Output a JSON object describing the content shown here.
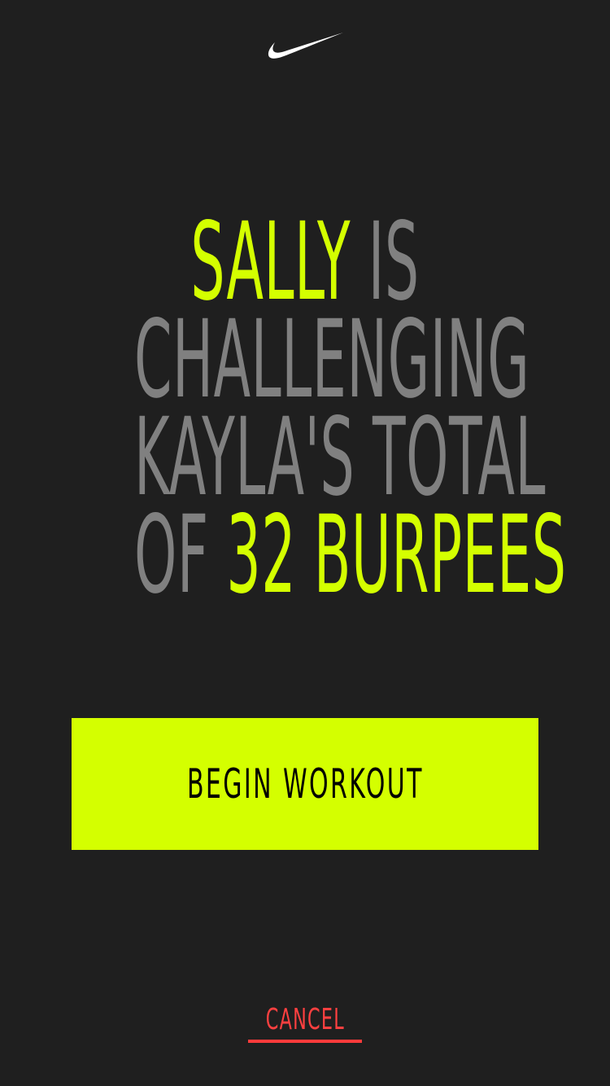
{
  "app": {
    "logo_icon": "nike-swoosh-icon"
  },
  "challenge": {
    "challenger": "SALLY",
    "line1_rest": " IS",
    "line2": "CHALLENGING",
    "line3": "KAYLA'S TOTAL",
    "line4_prefix": "OF ",
    "total_text": "32 BURPEES"
  },
  "actions": {
    "begin_label": "BEGIN WORKOUT",
    "cancel_label": "CANCEL"
  },
  "colors": {
    "background": "#1f1f1f",
    "accent": "#d4ff00",
    "muted_text": "#808080",
    "cancel": "#ff4040",
    "logo": "#ffffff"
  }
}
